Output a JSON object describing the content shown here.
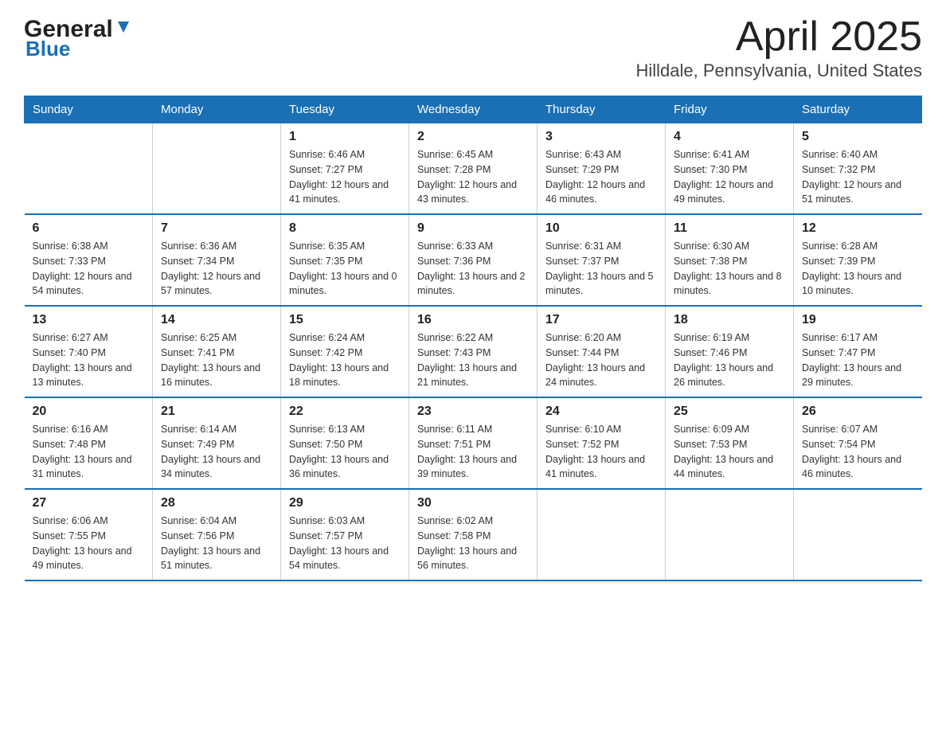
{
  "header": {
    "logo_general": "General",
    "logo_blue": "Blue",
    "title": "April 2025",
    "subtitle": "Hilldale, Pennsylvania, United States"
  },
  "weekdays": [
    "Sunday",
    "Monday",
    "Tuesday",
    "Wednesday",
    "Thursday",
    "Friday",
    "Saturday"
  ],
  "weeks": [
    [
      {
        "day": "",
        "sunrise": "",
        "sunset": "",
        "daylight": ""
      },
      {
        "day": "",
        "sunrise": "",
        "sunset": "",
        "daylight": ""
      },
      {
        "day": "1",
        "sunrise": "Sunrise: 6:46 AM",
        "sunset": "Sunset: 7:27 PM",
        "daylight": "Daylight: 12 hours and 41 minutes."
      },
      {
        "day": "2",
        "sunrise": "Sunrise: 6:45 AM",
        "sunset": "Sunset: 7:28 PM",
        "daylight": "Daylight: 12 hours and 43 minutes."
      },
      {
        "day": "3",
        "sunrise": "Sunrise: 6:43 AM",
        "sunset": "Sunset: 7:29 PM",
        "daylight": "Daylight: 12 hours and 46 minutes."
      },
      {
        "day": "4",
        "sunrise": "Sunrise: 6:41 AM",
        "sunset": "Sunset: 7:30 PM",
        "daylight": "Daylight: 12 hours and 49 minutes."
      },
      {
        "day": "5",
        "sunrise": "Sunrise: 6:40 AM",
        "sunset": "Sunset: 7:32 PM",
        "daylight": "Daylight: 12 hours and 51 minutes."
      }
    ],
    [
      {
        "day": "6",
        "sunrise": "Sunrise: 6:38 AM",
        "sunset": "Sunset: 7:33 PM",
        "daylight": "Daylight: 12 hours and 54 minutes."
      },
      {
        "day": "7",
        "sunrise": "Sunrise: 6:36 AM",
        "sunset": "Sunset: 7:34 PM",
        "daylight": "Daylight: 12 hours and 57 minutes."
      },
      {
        "day": "8",
        "sunrise": "Sunrise: 6:35 AM",
        "sunset": "Sunset: 7:35 PM",
        "daylight": "Daylight: 13 hours and 0 minutes."
      },
      {
        "day": "9",
        "sunrise": "Sunrise: 6:33 AM",
        "sunset": "Sunset: 7:36 PM",
        "daylight": "Daylight: 13 hours and 2 minutes."
      },
      {
        "day": "10",
        "sunrise": "Sunrise: 6:31 AM",
        "sunset": "Sunset: 7:37 PM",
        "daylight": "Daylight: 13 hours and 5 minutes."
      },
      {
        "day": "11",
        "sunrise": "Sunrise: 6:30 AM",
        "sunset": "Sunset: 7:38 PM",
        "daylight": "Daylight: 13 hours and 8 minutes."
      },
      {
        "day": "12",
        "sunrise": "Sunrise: 6:28 AM",
        "sunset": "Sunset: 7:39 PM",
        "daylight": "Daylight: 13 hours and 10 minutes."
      }
    ],
    [
      {
        "day": "13",
        "sunrise": "Sunrise: 6:27 AM",
        "sunset": "Sunset: 7:40 PM",
        "daylight": "Daylight: 13 hours and 13 minutes."
      },
      {
        "day": "14",
        "sunrise": "Sunrise: 6:25 AM",
        "sunset": "Sunset: 7:41 PM",
        "daylight": "Daylight: 13 hours and 16 minutes."
      },
      {
        "day": "15",
        "sunrise": "Sunrise: 6:24 AM",
        "sunset": "Sunset: 7:42 PM",
        "daylight": "Daylight: 13 hours and 18 minutes."
      },
      {
        "day": "16",
        "sunrise": "Sunrise: 6:22 AM",
        "sunset": "Sunset: 7:43 PM",
        "daylight": "Daylight: 13 hours and 21 minutes."
      },
      {
        "day": "17",
        "sunrise": "Sunrise: 6:20 AM",
        "sunset": "Sunset: 7:44 PM",
        "daylight": "Daylight: 13 hours and 24 minutes."
      },
      {
        "day": "18",
        "sunrise": "Sunrise: 6:19 AM",
        "sunset": "Sunset: 7:46 PM",
        "daylight": "Daylight: 13 hours and 26 minutes."
      },
      {
        "day": "19",
        "sunrise": "Sunrise: 6:17 AM",
        "sunset": "Sunset: 7:47 PM",
        "daylight": "Daylight: 13 hours and 29 minutes."
      }
    ],
    [
      {
        "day": "20",
        "sunrise": "Sunrise: 6:16 AM",
        "sunset": "Sunset: 7:48 PM",
        "daylight": "Daylight: 13 hours and 31 minutes."
      },
      {
        "day": "21",
        "sunrise": "Sunrise: 6:14 AM",
        "sunset": "Sunset: 7:49 PM",
        "daylight": "Daylight: 13 hours and 34 minutes."
      },
      {
        "day": "22",
        "sunrise": "Sunrise: 6:13 AM",
        "sunset": "Sunset: 7:50 PM",
        "daylight": "Daylight: 13 hours and 36 minutes."
      },
      {
        "day": "23",
        "sunrise": "Sunrise: 6:11 AM",
        "sunset": "Sunset: 7:51 PM",
        "daylight": "Daylight: 13 hours and 39 minutes."
      },
      {
        "day": "24",
        "sunrise": "Sunrise: 6:10 AM",
        "sunset": "Sunset: 7:52 PM",
        "daylight": "Daylight: 13 hours and 41 minutes."
      },
      {
        "day": "25",
        "sunrise": "Sunrise: 6:09 AM",
        "sunset": "Sunset: 7:53 PM",
        "daylight": "Daylight: 13 hours and 44 minutes."
      },
      {
        "day": "26",
        "sunrise": "Sunrise: 6:07 AM",
        "sunset": "Sunset: 7:54 PM",
        "daylight": "Daylight: 13 hours and 46 minutes."
      }
    ],
    [
      {
        "day": "27",
        "sunrise": "Sunrise: 6:06 AM",
        "sunset": "Sunset: 7:55 PM",
        "daylight": "Daylight: 13 hours and 49 minutes."
      },
      {
        "day": "28",
        "sunrise": "Sunrise: 6:04 AM",
        "sunset": "Sunset: 7:56 PM",
        "daylight": "Daylight: 13 hours and 51 minutes."
      },
      {
        "day": "29",
        "sunrise": "Sunrise: 6:03 AM",
        "sunset": "Sunset: 7:57 PM",
        "daylight": "Daylight: 13 hours and 54 minutes."
      },
      {
        "day": "30",
        "sunrise": "Sunrise: 6:02 AM",
        "sunset": "Sunset: 7:58 PM",
        "daylight": "Daylight: 13 hours and 56 minutes."
      },
      {
        "day": "",
        "sunrise": "",
        "sunset": "",
        "daylight": ""
      },
      {
        "day": "",
        "sunrise": "",
        "sunset": "",
        "daylight": ""
      },
      {
        "day": "",
        "sunrise": "",
        "sunset": "",
        "daylight": ""
      }
    ]
  ]
}
